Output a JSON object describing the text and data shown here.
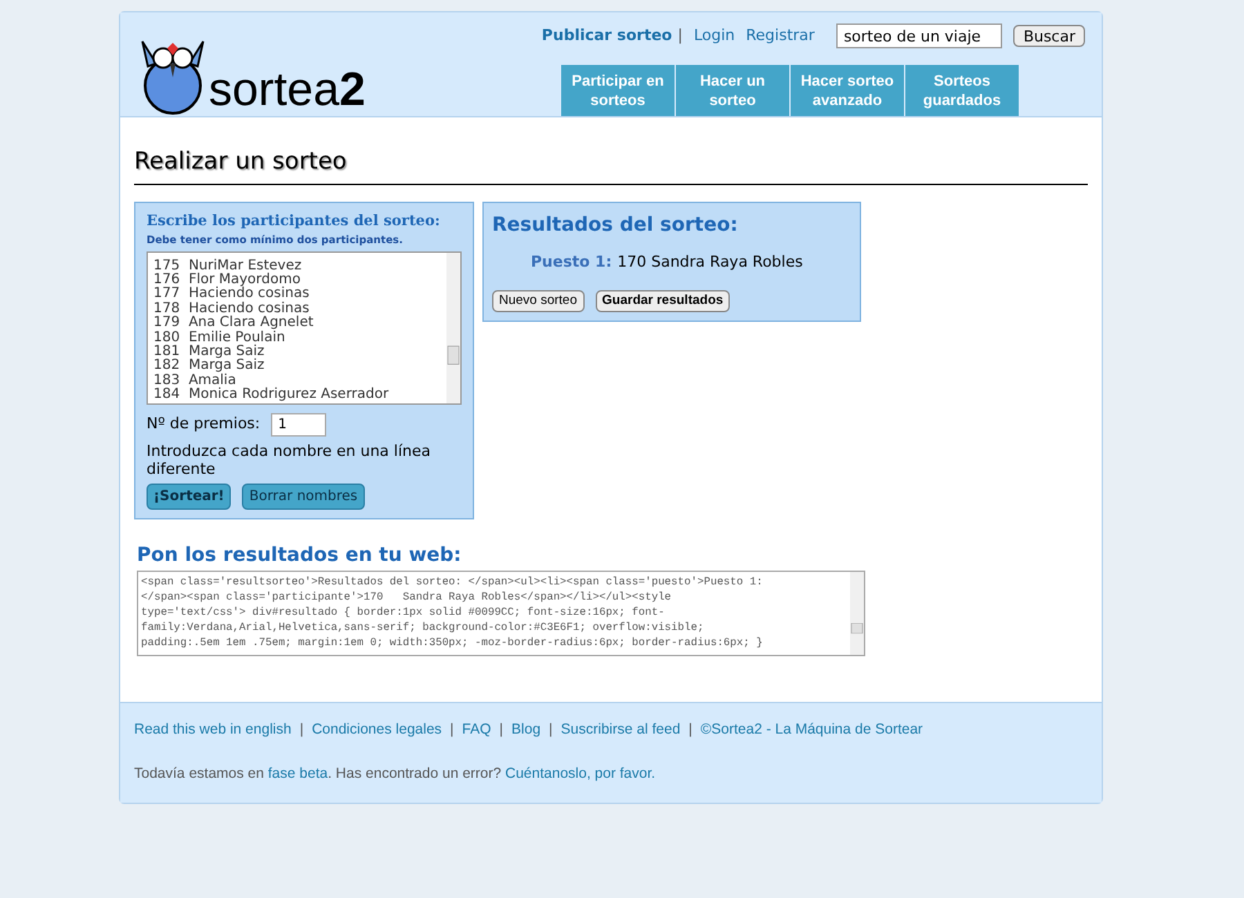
{
  "header": {
    "logo": "sortea**2**",
    "separator": "|",
    "top_links": [
      {
        "text": "Publicar sorteo",
        "bold": true
      },
      {
        "text": "Login",
        "bold": false
      },
      {
        "text": "Registrar",
        "bold": false
      }
    ],
    "search": {
      "value": "sorteo de un viaje",
      "button": "Buscar"
    },
    "nav": [
      {
        "label": "Participar en sorteos"
      },
      {
        "label": "Hacer un sorteo"
      },
      {
        "label": "Hacer sorteo avanzado"
      },
      {
        "label": "Sorteos guardados"
      }
    ]
  },
  "page_title": "Realizar un sorteo",
  "participants_panel": {
    "title": "Escribe los participantes del sorteo:",
    "hint": "Debe tener como mínimo dos participantes.",
    "lines": [
      "175  NuriMar Estevez",
      "176  Flor Mayordomo",
      "177  Haciendo cosinas",
      "178  Haciendo cosinas",
      "179  Ana Clara Agnelet",
      "180  Emilie Poulain",
      "181  Marga Saiz",
      "182  Marga Saiz",
      "183  Amalia",
      "184  Monica Rodrigurez Aserrador"
    ],
    "prizes_label": "Nº de premios:",
    "prizes_value": "1",
    "instruction": "Introduzca cada nombre en una línea diferente",
    "buttons": [
      "¡Sortear!",
      "Borrar nombres"
    ]
  },
  "results_panel": {
    "title": "Resultados del sorteo:",
    "winners": [
      {
        "place": "Puesto 1:",
        "name": "170 Sandra Raya Robles"
      }
    ],
    "buttons": [
      "Nuevo sorteo",
      "Guardar resultados"
    ]
  },
  "embed": {
    "title": "Pon los resultados en tu web:",
    "lines": [
      "<span class='resultsorteo'>Resultados del sorteo: </span><ul><li><span class='puesto'>Puesto 1:",
      "</span><span class='participante'>170   Sandra Raya Robles</span></li></ul><style",
      "type='text/css'> div#resultado { border:1px solid #0099CC; font-size:16px; font-",
      "family:Verdana,Arial,Helvetica,sans-serif; background-color:#C3E6F1; overflow:visible;",
      "padding:.5em 1em .75em; margin:1em 0; width:350px; -moz-border-radius:6px; border-radius:6px; }"
    ]
  },
  "footer": {
    "separator": "|",
    "links": [
      "Read this web in english",
      "Condiciones legales",
      "FAQ",
      "Blog",
      "Suscribirse al feed",
      "©Sortea2 - La Máquina de Sortear"
    ],
    "notice": [
      {
        "kind": "text",
        "text": "Todavía estamos en "
      },
      {
        "kind": "link",
        "text": "fase beta"
      },
      {
        "kind": "text",
        "text": ". Has encontrado un error? "
      },
      {
        "kind": "link",
        "text": "Cuéntanoslo, por favor."
      }
    ]
  }
}
